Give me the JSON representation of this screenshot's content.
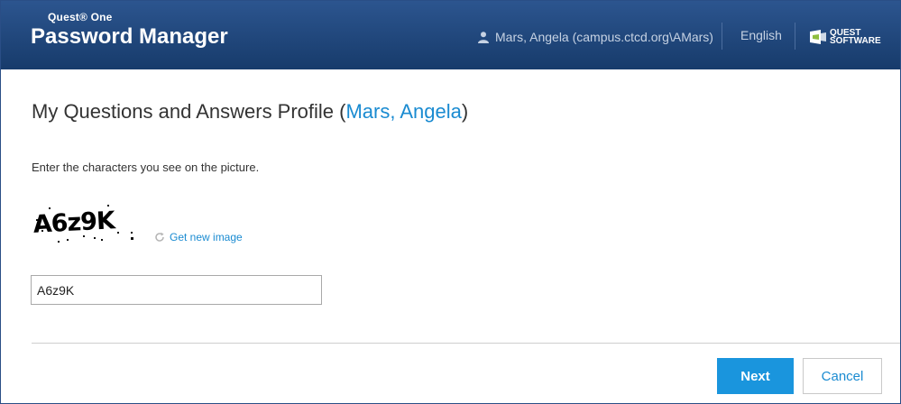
{
  "header": {
    "brand_top": "Quest® One",
    "brand_main": "Password Manager",
    "user_label": "Mars, Angela (campus.ctcd.org\\AMars)",
    "language": "English",
    "logo_line1": "QUEST",
    "logo_line2": "SOFTWARE"
  },
  "page": {
    "title_prefix": "My Questions and Answers Profile (",
    "title_user": "Mars, Angela",
    "title_suffix": ")",
    "instruction": "Enter the characters you see on the picture.",
    "captcha_text": "A6z9K",
    "get_new_image": "Get new image",
    "input_value": "A6z9K"
  },
  "footer": {
    "next_label": "Next",
    "cancel_label": "Cancel"
  },
  "colors": {
    "header_bg": "#1f4577",
    "link": "#1a8bd1",
    "primary_button": "#1a95dd"
  },
  "icons": {
    "user": "user-icon",
    "refresh": "refresh-icon",
    "logo": "quest-logo-icon"
  }
}
